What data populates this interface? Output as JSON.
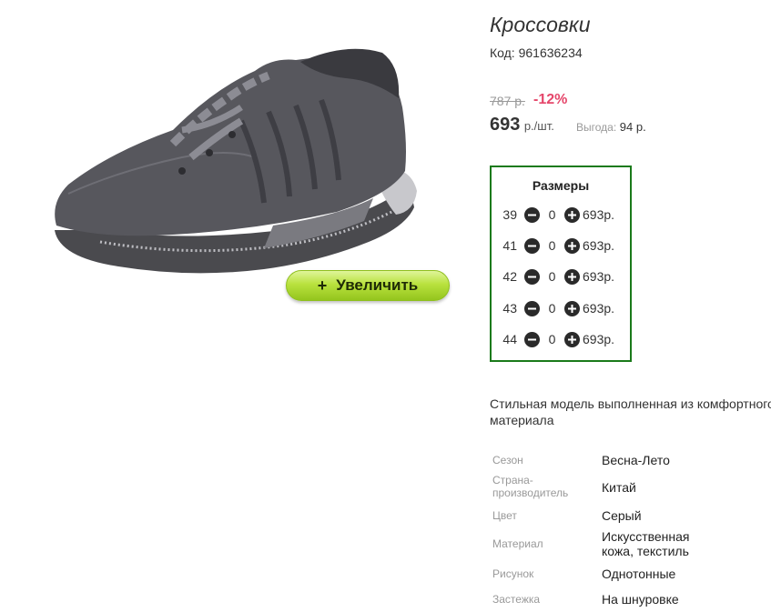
{
  "product": {
    "title": "Кроссовки",
    "code": "Код: 961636234",
    "old_price": "787 р.",
    "discount": "-12%",
    "price": "693",
    "price_unit": "р./шт.",
    "savings_label": "Выгода:",
    "savings_value": "94 р.",
    "zoom_button_label": "Увеличить",
    "zoom_button_icon": "+",
    "description": "Стильная модель выполненная из комфортного материала"
  },
  "sizes": {
    "title": "Размеры",
    "rows": [
      {
        "size": "39",
        "qty": "0",
        "price": "693р."
      },
      {
        "size": "41",
        "qty": "0",
        "price": "693р."
      },
      {
        "size": "42",
        "qty": "0",
        "price": "693р."
      },
      {
        "size": "43",
        "qty": "0",
        "price": "693р."
      },
      {
        "size": "44",
        "qty": "0",
        "price": "693р."
      }
    ]
  },
  "properties": [
    {
      "label": "Сезон",
      "value": "Весна-Лето"
    },
    {
      "label": "Страна-производитель",
      "value": "Китай"
    },
    {
      "label": "Цвет",
      "value": "Серый"
    },
    {
      "label": "Материал",
      "value": "Искусственная кожа, текстиль"
    },
    {
      "label": "Рисунок",
      "value": "Однотонные"
    },
    {
      "label": "Застежка",
      "value": "На шнуровке"
    }
  ],
  "colors": {
    "accent_green_border": "#1a7a1a",
    "discount_red": "#e5466a",
    "zoom_button_green": "#b9e23e"
  },
  "icons": [
    "minus-circle-icon",
    "plus-circle-icon",
    "plus-icon"
  ]
}
